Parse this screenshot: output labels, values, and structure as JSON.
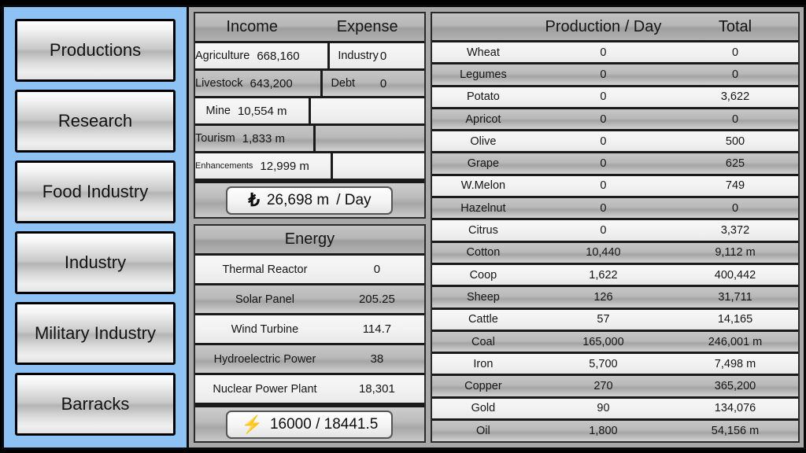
{
  "sidebar": {
    "items": [
      {
        "label": "Productions",
        "name": "productions"
      },
      {
        "label": "Research",
        "name": "research"
      },
      {
        "label": "Food Industry",
        "name": "food-industry"
      },
      {
        "label": "Industry",
        "name": "industry"
      },
      {
        "label": "Military Industry",
        "name": "military-industry"
      },
      {
        "label": "Barracks",
        "name": "barracks"
      }
    ]
  },
  "finance": {
    "income_header": "Income",
    "expense_header": "Expense",
    "rows": [
      {
        "income_label": "Agriculture",
        "income_value": "668,160",
        "expense_label": "Industry",
        "expense_value": "0"
      },
      {
        "income_label": "Livestock",
        "income_value": "643,200",
        "expense_label": "Debt",
        "expense_value": "0"
      },
      {
        "income_label": "Mine",
        "income_value": "10,554 m",
        "expense_label": "",
        "expense_value": ""
      },
      {
        "income_label": "Tourism",
        "income_value": "1,833 m",
        "expense_label": "",
        "expense_value": ""
      },
      {
        "income_label": "Enhancements",
        "income_value": "12,999 m",
        "expense_label": "",
        "expense_value": ""
      }
    ],
    "total": {
      "currency_symbol": "₺",
      "amount": "26,698 m",
      "suffix": "/ Day"
    }
  },
  "energy": {
    "header": "Energy",
    "rows": [
      {
        "label": "Thermal Reactor",
        "value": "0"
      },
      {
        "label": "Solar Panel",
        "value": "205.25"
      },
      {
        "label": "Wind Turbine",
        "value": "114.7"
      },
      {
        "label": "Hydroelectric Power",
        "value": "38"
      },
      {
        "label": "Nuclear Power Plant",
        "value": "18,301"
      }
    ],
    "total": {
      "icon": "⚡",
      "text": "16000 / 18441.5"
    }
  },
  "production": {
    "headers": {
      "name": "",
      "per_day": "Production / Day",
      "total": "Total"
    },
    "rows": [
      {
        "name": "Wheat",
        "per_day": "0",
        "total": "0"
      },
      {
        "name": "Legumes",
        "per_day": "0",
        "total": "0"
      },
      {
        "name": "Potato",
        "per_day": "0",
        "total": "3,622"
      },
      {
        "name": "Apricot",
        "per_day": "0",
        "total": "0"
      },
      {
        "name": "Olive",
        "per_day": "0",
        "total": "500"
      },
      {
        "name": "Grape",
        "per_day": "0",
        "total": "625"
      },
      {
        "name": "W.Melon",
        "per_day": "0",
        "total": "749"
      },
      {
        "name": "Hazelnut",
        "per_day": "0",
        "total": "0"
      },
      {
        "name": "Citrus",
        "per_day": "0",
        "total": "3,372"
      },
      {
        "name": "Cotton",
        "per_day": "10,440",
        "total": "9,112 m"
      },
      {
        "name": "Coop",
        "per_day": "1,622",
        "total": "400,442"
      },
      {
        "name": "Sheep",
        "per_day": "126",
        "total": "31,711"
      },
      {
        "name": "Cattle",
        "per_day": "57",
        "total": "14,165"
      },
      {
        "name": "Coal",
        "per_day": "165,000",
        "total": "246,001 m"
      },
      {
        "name": "Iron",
        "per_day": "5,700",
        "total": "7,498 m"
      },
      {
        "name": "Copper",
        "per_day": "270",
        "total": "365,200"
      },
      {
        "name": "Gold",
        "per_day": "90",
        "total": "134,076"
      },
      {
        "name": "Oil",
        "per_day": "1,800",
        "total": "54,156 m"
      }
    ]
  },
  "colors": {
    "sidebar_bg": "#8ec2f5",
    "panel_bg": "#a8a8a8",
    "border": "#1a1a1a",
    "row_light": "#f2f2f2",
    "row_dark": "#b9b9b9",
    "text": "#141414"
  }
}
